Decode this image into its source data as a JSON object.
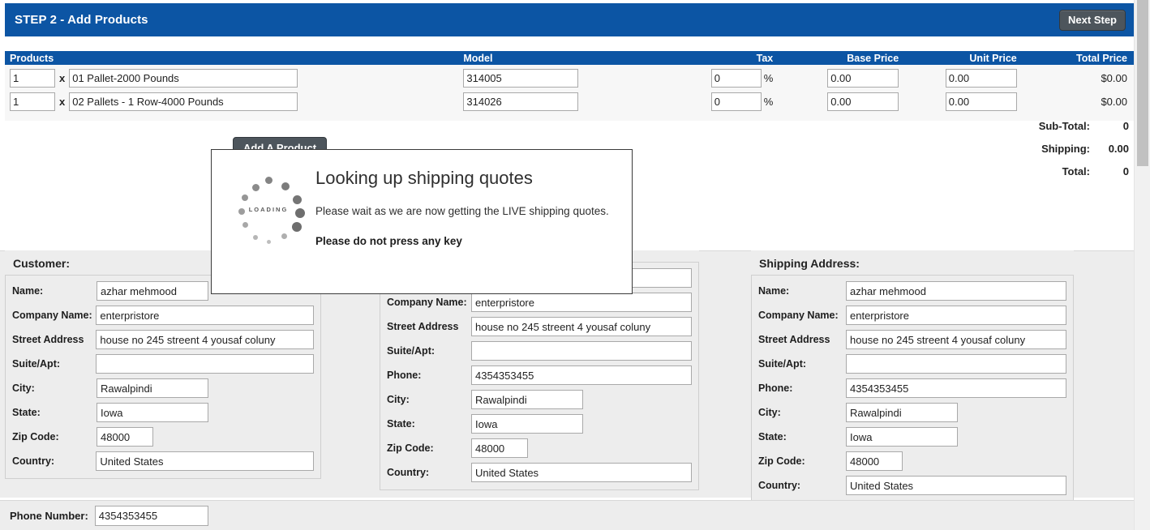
{
  "step_bar": {
    "title": "STEP 2 - Add Products",
    "next_button": "Next Step",
    "accent_color": "#0c55a4",
    "button_color": "#4d555c"
  },
  "products_table": {
    "columns": {
      "products": "Products",
      "model": "Model",
      "tax": "Tax",
      "base_price": "Base Price",
      "unit_price": "Unit Price",
      "total_price": "Total Price"
    },
    "multiplier_symbol": "x",
    "percent_symbol": "%",
    "rows": [
      {
        "qty": "1",
        "name": "01 Pallet-2000 Pounds",
        "model": "314005",
        "tax": "0",
        "base_price": "0.00",
        "unit_price": "0.00",
        "total_price": "$0.00"
      },
      {
        "qty": "1",
        "name": "02 Pallets - 1 Row-4000 Pounds",
        "model": "314026",
        "tax": "0",
        "base_price": "0.00",
        "unit_price": "0.00",
        "total_price": "$0.00"
      }
    ],
    "add_product_button": "Add A Product"
  },
  "totals": {
    "sub_total_label": "Sub-Total:",
    "sub_total_value": "0",
    "shipping_label": "Shipping:",
    "shipping_value": "0.00",
    "total_label": "Total:",
    "total_value": "0"
  },
  "modal": {
    "title": "Looking up shipping quotes",
    "message": "Please wait as we are now getting the LIVE shipping quotes.",
    "warning": "Please do not press any key",
    "spinner_label": "LOADING"
  },
  "customer_panel": {
    "title": "Customer:",
    "fields": {
      "name_label": "Name:",
      "name_value": "azhar mehmood",
      "company_label": "Company Name:",
      "company_value": "enterpristore",
      "street_label": "Street Address",
      "street_value": "house no 245 streent 4 yousaf coluny",
      "suite_label": "Suite/Apt:",
      "suite_value": "",
      "city_label": "City:",
      "city_value": "Rawalpindi",
      "state_label": "State:",
      "state_value": "Iowa",
      "zip_label": "Zip Code:",
      "zip_value": "48000",
      "country_label": "Country:",
      "country_value": "United States"
    }
  },
  "billing_panel": {
    "title": "",
    "fields": {
      "name_label": "",
      "name_value": "",
      "company_label": "Company Name:",
      "company_value": "enterpristore",
      "street_label": "Street Address",
      "street_value": "house no 245 streent 4 yousaf coluny",
      "suite_label": "Suite/Apt:",
      "suite_value": "",
      "phone_label": "Phone:",
      "phone_value": "4354353455",
      "city_label": "City:",
      "city_value": "Rawalpindi",
      "state_label": "State:",
      "state_value": "Iowa",
      "zip_label": "Zip Code:",
      "zip_value": "48000",
      "country_label": "Country:",
      "country_value": "United States"
    }
  },
  "shipping_panel": {
    "title": "Shipping Address:",
    "fields": {
      "name_label": "Name:",
      "name_value": "azhar mehmood",
      "company_label": "Company Name:",
      "company_value": "enterpristore",
      "street_label": "Street Address",
      "street_value": "house no 245 streent 4 yousaf coluny",
      "suite_label": "Suite/Apt:",
      "suite_value": "",
      "phone_label": "Phone:",
      "phone_value": "4354353455",
      "city_label": "City:",
      "city_value": "Rawalpindi",
      "state_label": "State:",
      "state_value": "Iowa",
      "zip_label": "Zip Code:",
      "zip_value": "48000",
      "country_label": "Country:",
      "country_value": "United States"
    }
  },
  "phone_row": {
    "label": "Phone Number:",
    "value": "4354353455"
  }
}
